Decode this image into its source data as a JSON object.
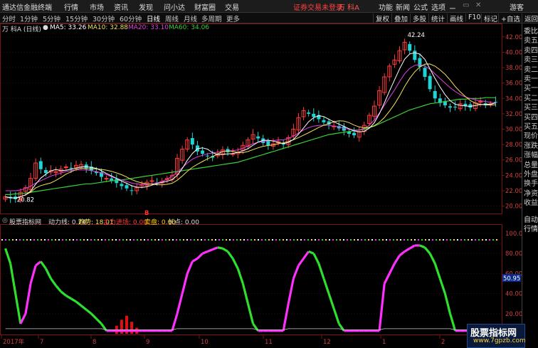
{
  "titlebar": {
    "app_name": "通达信金融终端",
    "menus": [
      "行情",
      "市场",
      "资讯",
      "发现",
      "问小达",
      "财富圈",
      "交易"
    ],
    "warning": "证券交易未登录",
    "stock": "万 科A",
    "right_menus": [
      "功能",
      "新闻",
      "公式",
      "选项"
    ],
    "guest": "游客"
  },
  "toolbar": {
    "periods": [
      "分时",
      "1分钟",
      "5分钟",
      "15分钟",
      "30分钟",
      "60分钟",
      "日线",
      "周线",
      "月线",
      "多周期",
      "更多"
    ],
    "active_period": "日线",
    "buttons": [
      "复权",
      "叠加",
      "多股",
      "统计",
      "画线",
      "F10",
      "标记",
      "+自选",
      "返回"
    ]
  },
  "price_info": {
    "stock_label": "万 科A (日线)",
    "ma5": "MA5: 33.26",
    "ma10": "MA10: 32.88",
    "ma20": "MA20: 33.10",
    "ma60": "MA60: 34.06",
    "high_label": "42.24",
    "low_label": "20.82"
  },
  "indicator_info": {
    "name": "股票指标网",
    "power_line": "动力线: 0.74",
    "trend": "趋势: 18.01",
    "main_force": "主力进场: 0.00",
    "sell": "卖盘: 0.00",
    "long": "长点: 0.00",
    "cursor_value": "50.95",
    "b_marker": "B"
  },
  "price_axis": [
    "42.00",
    "40.00",
    "38.00",
    "36.00",
    "34.00",
    "32.00",
    "30.00",
    "28.00",
    "26.00",
    "24.00",
    "22.00",
    "20.00"
  ],
  "indicator_axis": [
    "100.00",
    "80.00",
    "60.00",
    "40.00",
    "20.00"
  ],
  "date_axis": [
    "2017年",
    "7",
    "8",
    "9",
    "10",
    "11",
    "12",
    "1",
    "2"
  ],
  "right_panel": [
    "委比",
    "卖五",
    "卖四",
    "卖三",
    "卖二",
    "卖一",
    "买一",
    "买二",
    "买三",
    "买四",
    "买五",
    "现价",
    "涨跌",
    "涨幅",
    "总量",
    "外盘",
    "换手",
    "净资",
    "收益",
    "自动",
    "行情"
  ],
  "colors": {
    "up": "#ff3b3b",
    "down": "#21d4d4",
    "ma5": "#ffffff",
    "ma10": "#f2e05a",
    "ma20": "#e040e0",
    "ma60": "#38d038",
    "green_band": "#2ee02e",
    "magenta_band": "#ff30ff"
  },
  "watermark": {
    "line1": "股票指标网",
    "line2": "www.7gpzb.com"
  },
  "chart_data": {
    "type": "candlestick",
    "ylim": [
      19.5,
      43
    ],
    "indicator_ylim": [
      0,
      100
    ],
    "close": [
      21.2,
      21.0,
      20.9,
      21.8,
      22.4,
      23.6,
      25.6,
      24.8,
      24.3,
      24.6,
      24.5,
      24.8,
      25.1,
      24.9,
      25.3,
      25.4,
      24.9,
      24.6,
      24.3,
      23.8,
      23.6,
      23.3,
      23.0,
      22.6,
      22.3,
      22.0,
      22.4,
      22.8,
      23.1,
      23.3,
      23.0,
      23.2,
      23.6,
      24.0,
      26.2,
      27.4,
      28.6,
      28.0,
      27.1,
      26.8,
      26.5,
      26.3,
      26.8,
      27.3,
      27.0,
      26.8,
      27.0,
      27.9,
      28.6,
      29.3,
      28.8,
      28.2,
      27.9,
      28.1,
      28.4,
      28.0,
      28.9,
      30.0,
      31.5,
      32.4,
      32.0,
      31.6,
      31.3,
      30.9,
      30.6,
      30.4,
      30.1,
      29.8,
      29.4,
      29.2,
      29.7,
      30.5,
      31.8,
      33.0,
      35.0,
      36.8,
      38.2,
      39.0,
      40.2,
      41.3,
      40.2,
      39.0,
      38.1,
      36.8,
      35.2,
      34.0,
      33.4,
      33.1,
      32.8,
      32.9,
      33.3,
      33.0,
      32.8,
      33.4,
      33.6,
      33.2,
      33.3,
      33.5
    ],
    "ma20": [
      22.0,
      22.0,
      22.0,
      22.1,
      22.3,
      22.6,
      23.0,
      23.3,
      23.6,
      23.9,
      24.1,
      24.3,
      24.5,
      24.6,
      24.7,
      24.7,
      24.7,
      24.6,
      24.5,
      24.3,
      24.1,
      23.8,
      23.6,
      23.4,
      23.2,
      23.0,
      22.9,
      22.8,
      22.8,
      22.9,
      23.0,
      23.2,
      23.5,
      23.9,
      24.4,
      25.0,
      25.6,
      26.1,
      26.4,
      26.6,
      26.8,
      26.9,
      27.0,
      27.1,
      27.2,
      27.2,
      27.3,
      27.5,
      27.8,
      28.1,
      28.3,
      28.4,
      28.5,
      28.5,
      28.6,
      28.6,
      28.8,
      29.1,
      29.5,
      29.9,
      30.2,
      30.4,
      30.5,
      30.5,
      30.5,
      30.4,
      30.3,
      30.1,
      30.0,
      29.9,
      29.9,
      30.1,
      30.5,
      31.2,
      32.1,
      33.1,
      34.1,
      35.1,
      36.2,
      37.2,
      37.9,
      38.3,
      38.4,
      38.2,
      37.8,
      37.2,
      36.6,
      36.0,
      35.4,
      34.9,
      34.5,
      34.2,
      34.0,
      33.8,
      33.7,
      33.6,
      33.5,
      33.4
    ],
    "ma60": [
      21.5,
      21.5,
      21.6,
      21.6,
      21.7,
      21.8,
      21.9,
      22.0,
      22.1,
      22.2,
      22.3,
      22.4,
      22.5,
      22.6,
      22.7,
      22.8,
      22.9,
      22.9,
      23.0,
      23.1,
      23.2,
      23.3,
      23.3,
      23.4,
      23.5,
      23.6,
      23.7,
      23.8,
      23.9,
      24.0,
      24.1,
      24.2,
      24.3,
      24.4,
      24.5,
      24.6,
      24.7,
      24.8,
      24.9,
      25.0,
      25.1,
      25.2,
      25.3,
      25.4,
      25.5,
      25.6,
      25.7,
      25.9,
      26.1,
      26.3,
      26.5,
      26.7,
      26.9,
      27.1,
      27.3,
      27.5,
      27.7,
      27.9,
      28.1,
      28.3,
      28.5,
      28.7,
      28.9,
      29.1,
      29.3,
      29.4,
      29.5,
      29.6,
      29.7,
      29.8,
      29.9,
      30.0,
      30.2,
      30.4,
      30.7,
      31.0,
      31.3,
      31.6,
      31.9,
      32.2,
      32.5,
      32.7,
      32.9,
      33.1,
      33.3,
      33.4,
      33.5,
      33.6,
      33.7,
      33.8,
      33.9,
      33.9,
      34.0,
      34.0,
      34.0,
      34.1,
      34.1,
      34.1
    ],
    "trend": [
      85,
      70,
      40,
      10,
      20,
      50,
      68,
      72,
      65,
      55,
      48,
      42,
      38,
      35,
      32,
      28,
      24,
      20,
      15,
      10,
      3,
      3,
      3,
      3,
      3,
      3,
      3,
      3,
      3,
      3,
      3,
      3,
      3,
      3,
      20,
      40,
      60,
      72,
      75,
      80,
      82,
      84,
      86,
      85,
      82,
      75,
      65,
      50,
      30,
      10,
      3,
      3,
      3,
      3,
      3,
      3,
      30,
      55,
      68,
      75,
      82,
      80,
      70,
      55,
      40,
      25,
      10,
      3,
      3,
      3,
      3,
      3,
      3,
      3,
      3,
      50,
      60,
      70,
      78,
      82,
      85,
      88,
      88,
      86,
      80,
      70,
      55,
      40,
      20,
      3,
      3,
      3,
      3,
      3,
      3,
      3,
      3,
      8
    ],
    "main_force_bars": [
      0,
      0,
      0,
      0,
      0,
      0,
      0,
      0,
      0,
      0,
      0,
      0,
      0,
      0,
      0,
      0,
      0,
      0,
      0,
      0,
      0,
      0,
      8,
      14,
      18,
      12,
      6,
      0,
      0,
      0,
      0,
      0,
      0,
      0,
      0,
      0,
      0,
      0,
      0,
      0,
      0,
      0,
      0,
      0,
      0,
      0,
      0,
      0,
      0,
      0,
      0,
      0,
      0,
      0,
      0,
      0,
      0,
      0,
      0,
      0,
      0,
      0,
      0,
      0,
      0,
      0,
      0,
      0,
      0,
      0,
      0,
      0,
      0,
      0,
      0,
      0,
      0,
      0,
      0,
      0,
      0,
      0,
      0,
      0,
      0,
      0,
      0,
      0,
      0,
      0,
      0,
      0,
      0,
      0,
      0,
      0,
      0,
      0
    ]
  }
}
